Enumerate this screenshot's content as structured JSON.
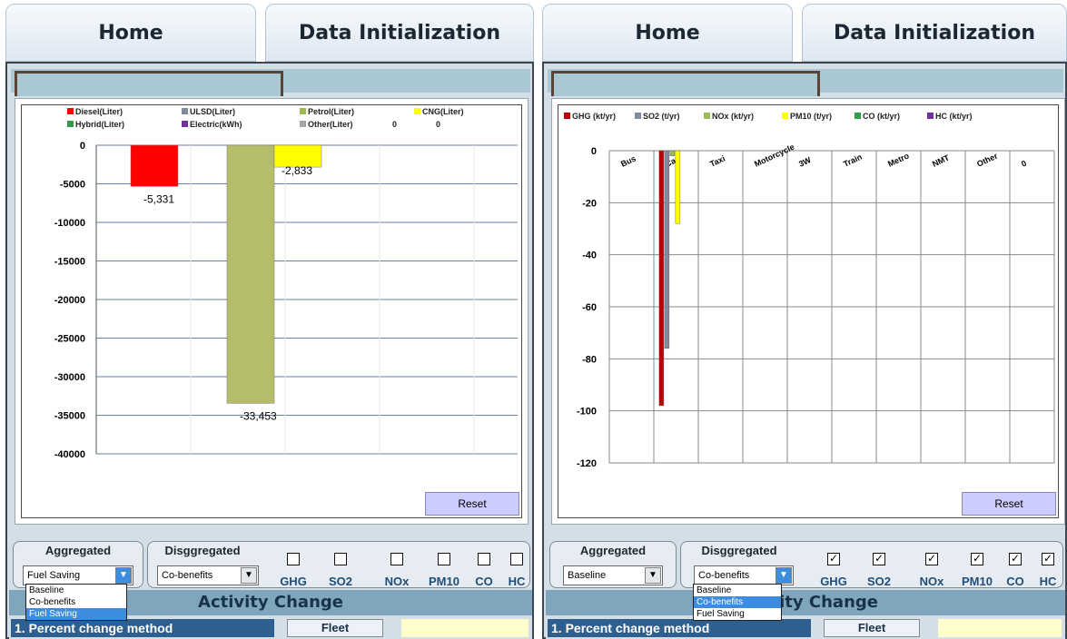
{
  "tabs": {
    "home": "Home",
    "data_init": "Data Initialization"
  },
  "reset_label": "Reset",
  "activity_change": "Activity Change",
  "percent_change": "1. Percent change method",
  "fleet_label": "Fleet",
  "aggregated_label": "Aggregated",
  "disaggregated_label": "Disggregated",
  "pollutant_labels": [
    "GHG",
    "SO2",
    "NOx",
    "PM10",
    "CO",
    "HC"
  ],
  "dropdown_options": [
    "Baseline",
    "Co-benefits",
    "Fuel Saving"
  ],
  "left": {
    "aggregated_value": "Fuel Saving",
    "disaggregated_value": "Co-benefits",
    "open_dropdown_selected": "Fuel Saving",
    "checkboxes": [
      false,
      false,
      false,
      false,
      false,
      false
    ],
    "chart_data": {
      "type": "bar",
      "legend": [
        "Diesel(Liter)",
        "ULSD(Liter)",
        "Petrol(Liter)",
        "CNG(Liter)",
        "Hybrid(Liter)",
        "Electric(kWh)",
        "Other(Liter)",
        "0",
        "0"
      ],
      "series": [
        {
          "name": "Diesel(Liter)",
          "values": [
            -5331
          ],
          "label": "-5,331",
          "color": "#ff0000"
        },
        {
          "name": "ULSD(Liter)",
          "values": [
            0
          ],
          "color": "#7f8c9d"
        },
        {
          "name": "Petrol(Liter)",
          "values": [
            -33453
          ],
          "label": "-33,453",
          "color": "#b5bd6b"
        },
        {
          "name": "CNG(Liter)",
          "values": [
            -2833
          ],
          "label": "-2,833",
          "color": "#ffff00"
        }
      ],
      "y_ticks": [
        0,
        -5000,
        -10000,
        -15000,
        -20000,
        -25000,
        -30000,
        -35000,
        -40000
      ],
      "ylim": [
        -40000,
        0
      ],
      "legend_colors": [
        "#ff0000",
        "#7f8c9d",
        "#9bbb59",
        "#ffff00",
        "#2e9e4a",
        "#7030a0",
        "#a6a6a6"
      ]
    }
  },
  "right": {
    "aggregated_value": "Baseline",
    "disaggregated_value": "Co-benefits",
    "open_dropdown_selected": "Co-benefits",
    "checkboxes": [
      true,
      true,
      true,
      true,
      true,
      true
    ],
    "chart_data": {
      "type": "bar",
      "legend": [
        "GHG (kt/yr)",
        "SO2 (t/yr)",
        "NOx (kt/yr)",
        "PM10 (t/yr)",
        "CO (kt/yr)",
        "HC (kt/yr)"
      ],
      "categories": [
        "Bus",
        "Car",
        "Taxi",
        "Motorcycle",
        "3W",
        "Train",
        "Metro",
        "NMT",
        "Other",
        "0"
      ],
      "series": [
        {
          "name": "GHG (kt/yr)",
          "values": [
            0,
            -98,
            0,
            0,
            0,
            0,
            0,
            0,
            0,
            0
          ],
          "color": "#c00000"
        },
        {
          "name": "SO2 (t/yr)",
          "values": [
            0,
            -76,
            0,
            0,
            0,
            0,
            0,
            0,
            0,
            0
          ],
          "color": "#7f8c9d"
        },
        {
          "name": "NOx (kt/yr)",
          "values": [
            0,
            -2,
            0,
            0,
            0,
            0,
            0,
            0,
            0,
            0
          ],
          "color": "#9bbb59"
        },
        {
          "name": "PM10 (t/yr)",
          "values": [
            0,
            -28,
            0,
            0,
            0,
            0,
            0,
            0,
            0,
            0
          ],
          "color": "#ffff00"
        },
        {
          "name": "CO (kt/yr)",
          "values": [
            0,
            0,
            0,
            0,
            0,
            0,
            0,
            0,
            0,
            0
          ],
          "color": "#2e9e4a"
        },
        {
          "name": "HC (kt/yr)",
          "values": [
            0,
            0,
            0,
            0,
            0,
            0,
            0,
            0,
            0,
            0
          ],
          "color": "#7030a0"
        }
      ],
      "y_ticks": [
        0,
        -20,
        -40,
        -60,
        -80,
        -100,
        -120
      ],
      "ylim": [
        -120,
        0
      ]
    }
  }
}
